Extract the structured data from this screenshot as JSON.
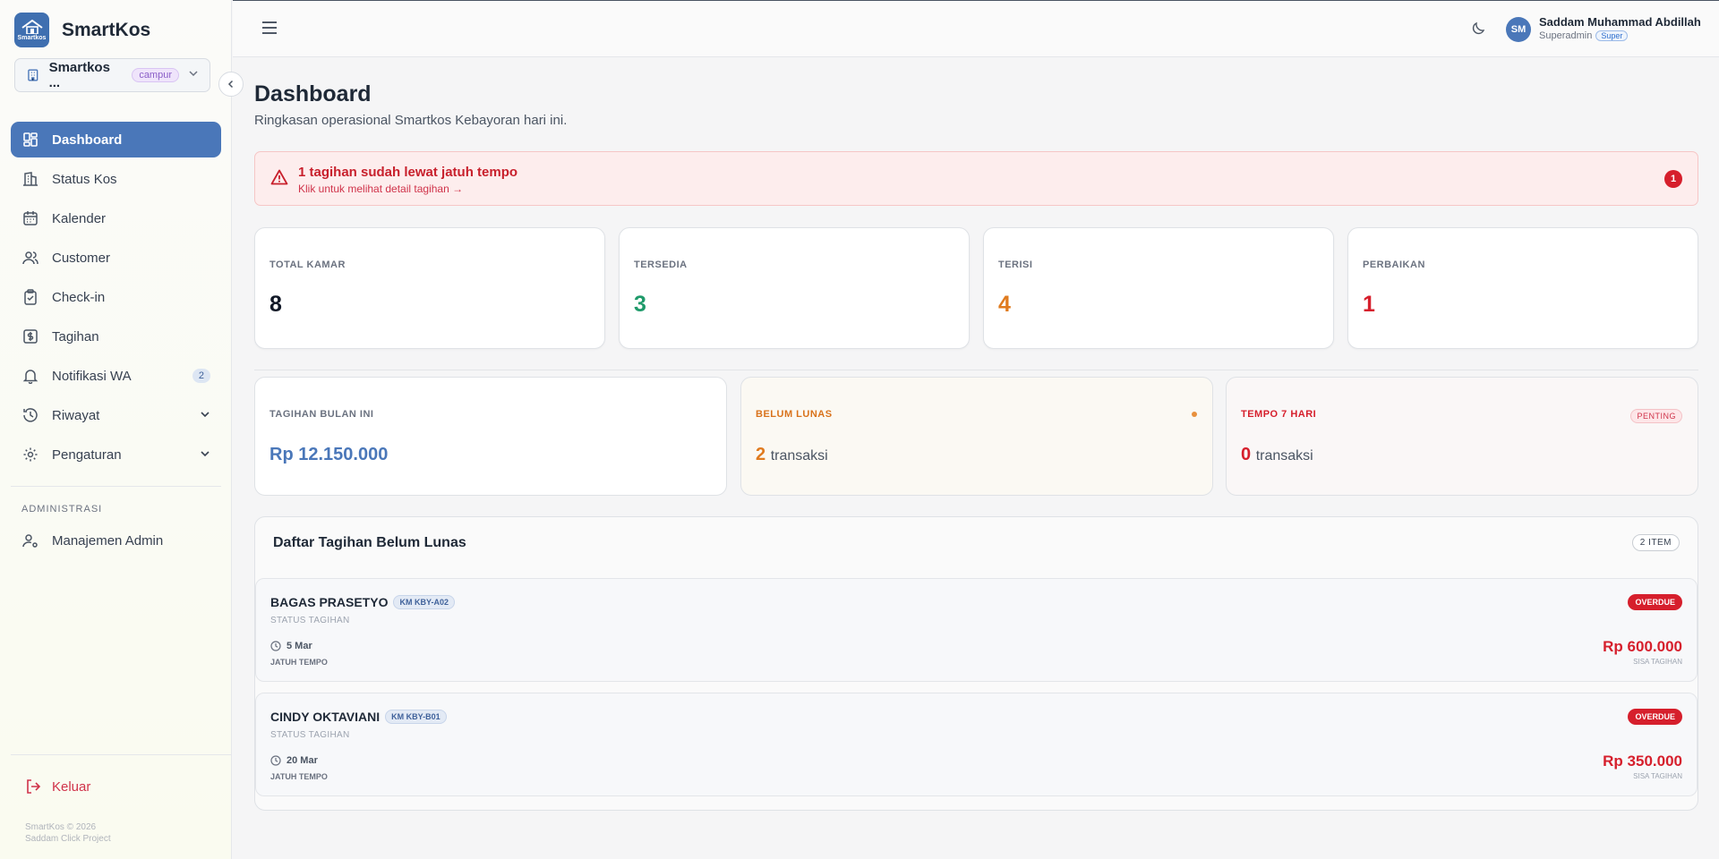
{
  "sidebar": {
    "brand_name": "SmartKos",
    "logo_text": "Smartkos",
    "property": {
      "name": "Smartkos ...",
      "tag": "campur"
    },
    "nav": [
      {
        "label": "Dashboard",
        "icon": "dashboard-icon",
        "active": true
      },
      {
        "label": "Status Kos",
        "icon": "building-icon"
      },
      {
        "label": "Kalender",
        "icon": "calendar-icon"
      },
      {
        "label": "Customer",
        "icon": "users-icon"
      },
      {
        "label": "Check-in",
        "icon": "clipboard-check-icon"
      },
      {
        "label": "Tagihan",
        "icon": "dollar-receipt-icon"
      },
      {
        "label": "Notifikasi WA",
        "icon": "bell-icon",
        "count": "2"
      },
      {
        "label": "Riwayat",
        "icon": "history-icon"
      },
      {
        "label": "Pengaturan",
        "icon": "gear-icon"
      }
    ],
    "section_label": "ADMINISTRASI",
    "admin_item": "Manajemen Admin",
    "logout": "Keluar",
    "footer_line1": "SmartKos © 2026",
    "footer_line2": "Saddam Click Project"
  },
  "topbar": {
    "user_initials": "SM",
    "user_name": "Saddam Muhammad Abdillah",
    "user_role": "Superadmin",
    "user_badge": "Super"
  },
  "page": {
    "title": "Dashboard",
    "subtitle": "Ringkasan operasional Smartkos Kebayoran hari ini."
  },
  "alert": {
    "title": "1 tagihan sudah lewat jatuh tempo",
    "link": "Klik untuk melihat detail tagihan →",
    "count": "1"
  },
  "stats": [
    {
      "label": "TOTAL KAMAR",
      "value": "8",
      "color": "#111827"
    },
    {
      "label": "TERSEDIA",
      "value": "3",
      "color": "#1f9a6a"
    },
    {
      "label": "TERISI",
      "value": "4",
      "color": "#e07b1f"
    },
    {
      "label": "PERBAIKAN",
      "value": "1",
      "color": "#d61f2c"
    }
  ],
  "finance": {
    "month": {
      "label": "TAGIHAN BULAN INI",
      "value": "Rp 12.150.000"
    },
    "unpaid": {
      "label": "BELUM LUNAS",
      "value": "2",
      "unit": "transaksi"
    },
    "due7": {
      "label": "TEMPO 7 HARI",
      "value": "0",
      "unit": "transaksi",
      "badge": "PENTING"
    }
  },
  "bills": {
    "title": "Daftar Tagihan Belum Lunas",
    "count": "2 ITEM",
    "items": [
      {
        "name": "BAGAS PRASETYO",
        "room": "KM KBY-A02",
        "status_label": "STATUS TAGIHAN",
        "date": "5 Mar",
        "date_label": "JATUH TEMPO",
        "badge": "OVERDUE",
        "amount": "Rp 600.000",
        "amount_label": "SISA TAGIHAN"
      },
      {
        "name": "CINDY OKTAVIANI",
        "room": "KM KBY-B01",
        "status_label": "STATUS TAGIHAN",
        "date": "20 Mar",
        "date_label": "JATUH TEMPO",
        "badge": "OVERDUE",
        "amount": "Rp 350.000",
        "amount_label": "SISA TAGIHAN"
      }
    ]
  }
}
